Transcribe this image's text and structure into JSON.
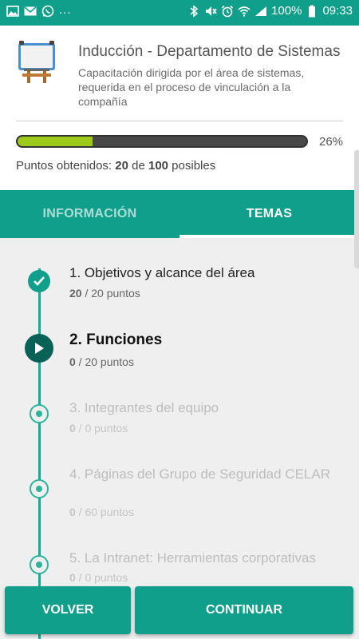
{
  "status_bar": {
    "left_icons": [
      "image-icon",
      "mail-icon",
      "whatsapp-icon"
    ],
    "more": "...",
    "right_icons": [
      "bluetooth-icon",
      "mute-icon",
      "alarm-icon",
      "wifi-icon",
      "signal-icon"
    ],
    "battery": "100%",
    "time": "09:33"
  },
  "course": {
    "icon": "whiteboard-icon",
    "title": "Inducción - Departamento de Sistemas",
    "description": "Capacitación dirigida por el área de sistemas, requerida en el proceso de vinculación a la compañía",
    "progress_percent": 26,
    "progress_label": "26%",
    "points_prefix": "Puntos obtenidos: ",
    "points_obtained": "20",
    "points_middle": " de ",
    "points_total": "100",
    "points_suffix": " posibles"
  },
  "tabs": [
    {
      "label": "INFORMACIÓN",
      "active": false
    },
    {
      "label": "TEMAS",
      "active": true
    }
  ],
  "topics": [
    {
      "title": "1. Objetivos y alcance del área",
      "earned": "20",
      "points": " / 20 puntos",
      "state": "done"
    },
    {
      "title": "2. Funciones",
      "earned": "0",
      "points": " / 20 puntos",
      "state": "current"
    },
    {
      "title": "3. Integrantes del equipo",
      "earned": "0",
      "points": " / 0 puntos",
      "state": "locked"
    },
    {
      "title": "4. Páginas del Grupo de Seguridad CELAR",
      "earned": "0",
      "points": " / 60 puntos",
      "state": "locked"
    },
    {
      "title": "5. La Intranet: Herramientas corporativas",
      "earned": "0",
      "points": " / 0 puntos",
      "state": "locked"
    }
  ],
  "buttons": {
    "back_label": "VOLVER",
    "continue_label": "CONTINUAR"
  },
  "colors": {
    "primary": "#0f9f8a",
    "progress_fill": "#9dc91a",
    "current_node": "#0a6155"
  }
}
